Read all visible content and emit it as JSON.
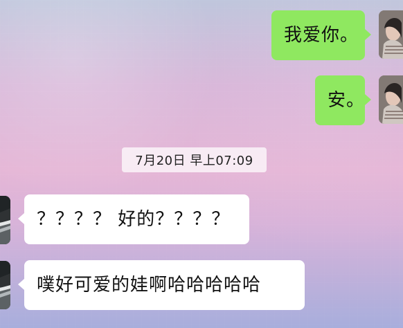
{
  "conversation": {
    "messages": [
      {
        "sender": "me",
        "text": "我爱你。"
      },
      {
        "sender": "me",
        "text": "安。"
      },
      {
        "sender": "other",
        "text": "？？？？ 好的？？？？"
      },
      {
        "sender": "other",
        "text": "噗好可爱的娃啊哈哈哈哈哈"
      }
    ],
    "timestamp": "7月20日 早上07:09"
  },
  "icons": {
    "my_avatar": "person-avatar-icon",
    "other_avatar": "landscape-avatar-icon"
  },
  "colors": {
    "outgoing_bubble": "#8fe860",
    "incoming_bubble": "#ffffff",
    "timestamp_chip": "#f3eef4",
    "background_top": "#bfc6dc",
    "background_mid": "#e5b6d6",
    "background_bottom": "#a8aedc"
  }
}
